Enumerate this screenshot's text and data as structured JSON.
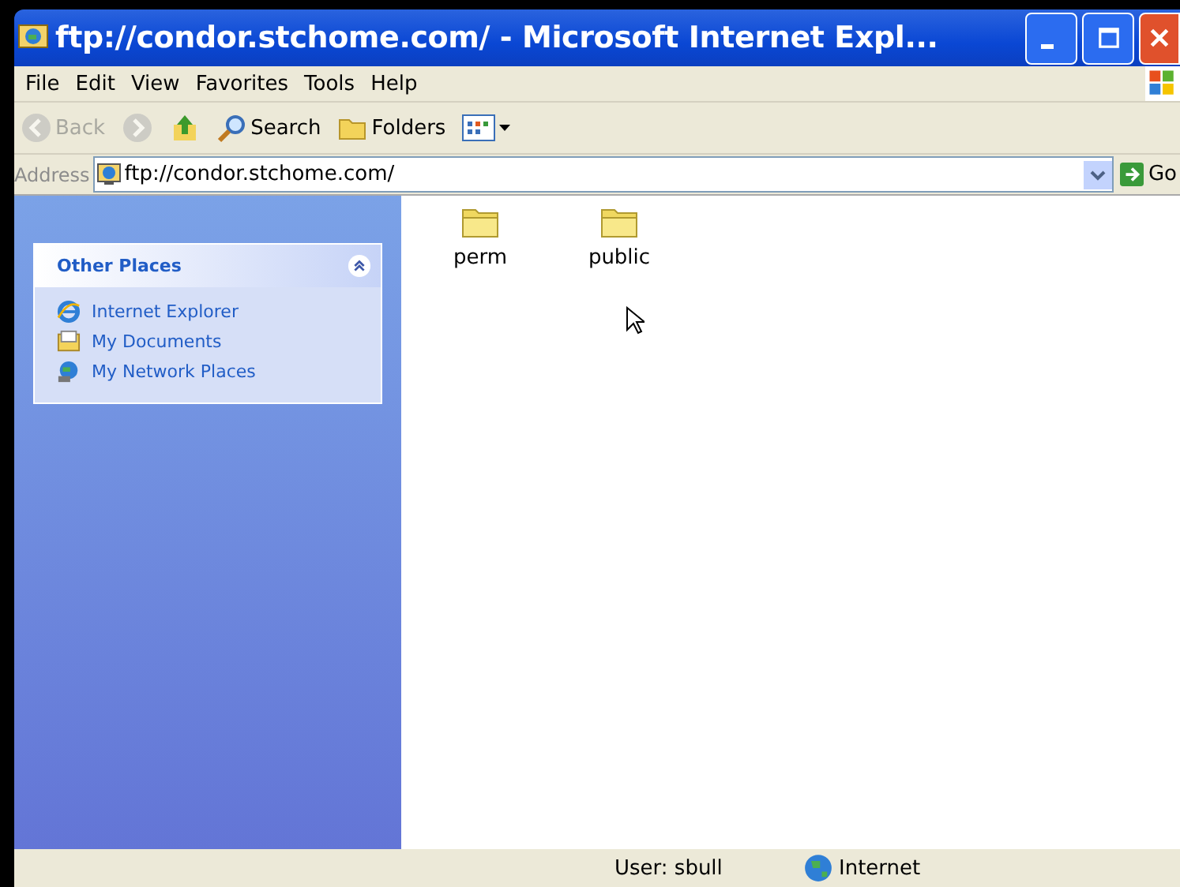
{
  "window": {
    "title": "ftp://condor.stchome.com/ - Microsoft Internet Expl..."
  },
  "menu": [
    "File",
    "Edit",
    "View",
    "Favorites",
    "Tools",
    "Help"
  ],
  "toolbar": [
    {
      "kind": "back",
      "label": "Back",
      "disabled": true
    },
    {
      "kind": "forward",
      "disabled": true
    },
    {
      "kind": "up",
      "disabled": false
    },
    {
      "kind": "search",
      "label": "Search",
      "disabled": false
    },
    {
      "kind": "folders",
      "label": "Folders",
      "disabled": false
    },
    {
      "kind": "views",
      "disabled": false
    }
  ],
  "address": {
    "label": "Address",
    "value": "ftp://condor.stchome.com/",
    "go": "Go"
  },
  "sidebar": {
    "title": "Other Places",
    "expanded": true,
    "items": [
      {
        "kind": "ie",
        "label": "Internet Explorer"
      },
      {
        "kind": "docs",
        "label": "My Documents"
      },
      {
        "kind": "network",
        "label": "My Network Places"
      }
    ]
  },
  "files": [
    {
      "name": "perm"
    },
    {
      "name": "public"
    }
  ],
  "status_bar": {
    "user": "User: sbull",
    "zone": "Internet"
  }
}
